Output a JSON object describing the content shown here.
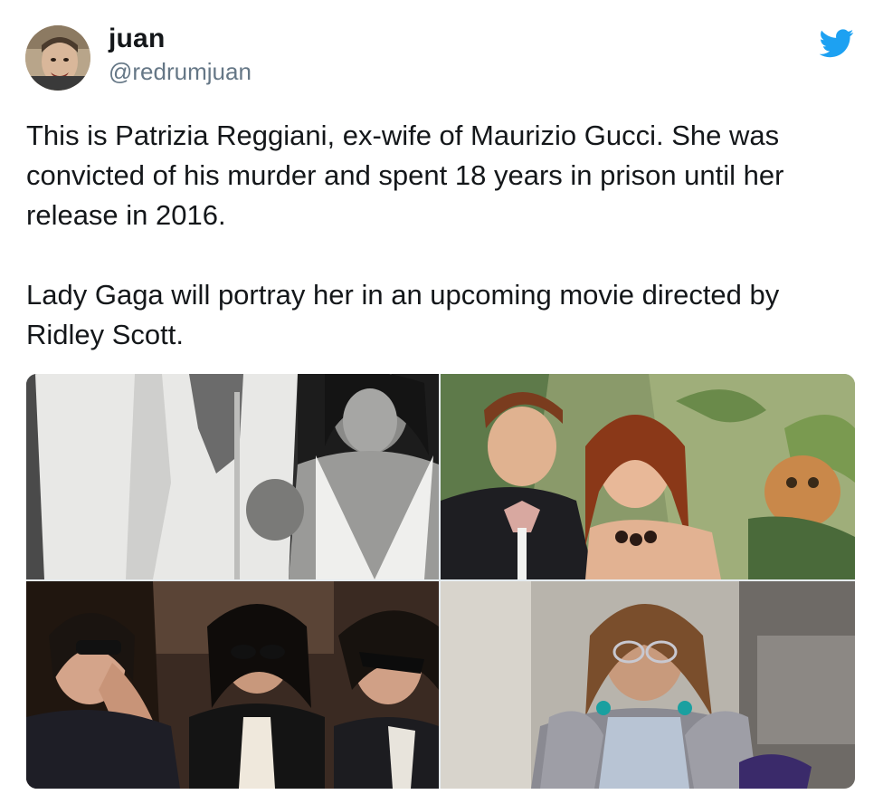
{
  "author": {
    "display_name": "juan",
    "handle": "@redrumjuan"
  },
  "tweet": {
    "text": "This is Patrizia Reggiani, ex-wife of Maurizio Gucci. She was convicted of his murder and spent 18 years in prison until her release in 2016.\n\nLady Gaga will portray her in an upcoming movie directed by Ridley Scott."
  },
  "icons": {
    "platform": "twitter-bird-icon"
  },
  "colors": {
    "twitter_blue": "#1da1f2",
    "handle_gray": "#657786",
    "text": "#14171a"
  },
  "media": {
    "photos": [
      {
        "subject": "black-and-white photo of couple"
      },
      {
        "subject": "color photo of couple in front of jungle painting"
      },
      {
        "subject": "women in sunglasses at a funeral"
      },
      {
        "subject": "woman in fur coat and glasses on street"
      }
    ]
  }
}
